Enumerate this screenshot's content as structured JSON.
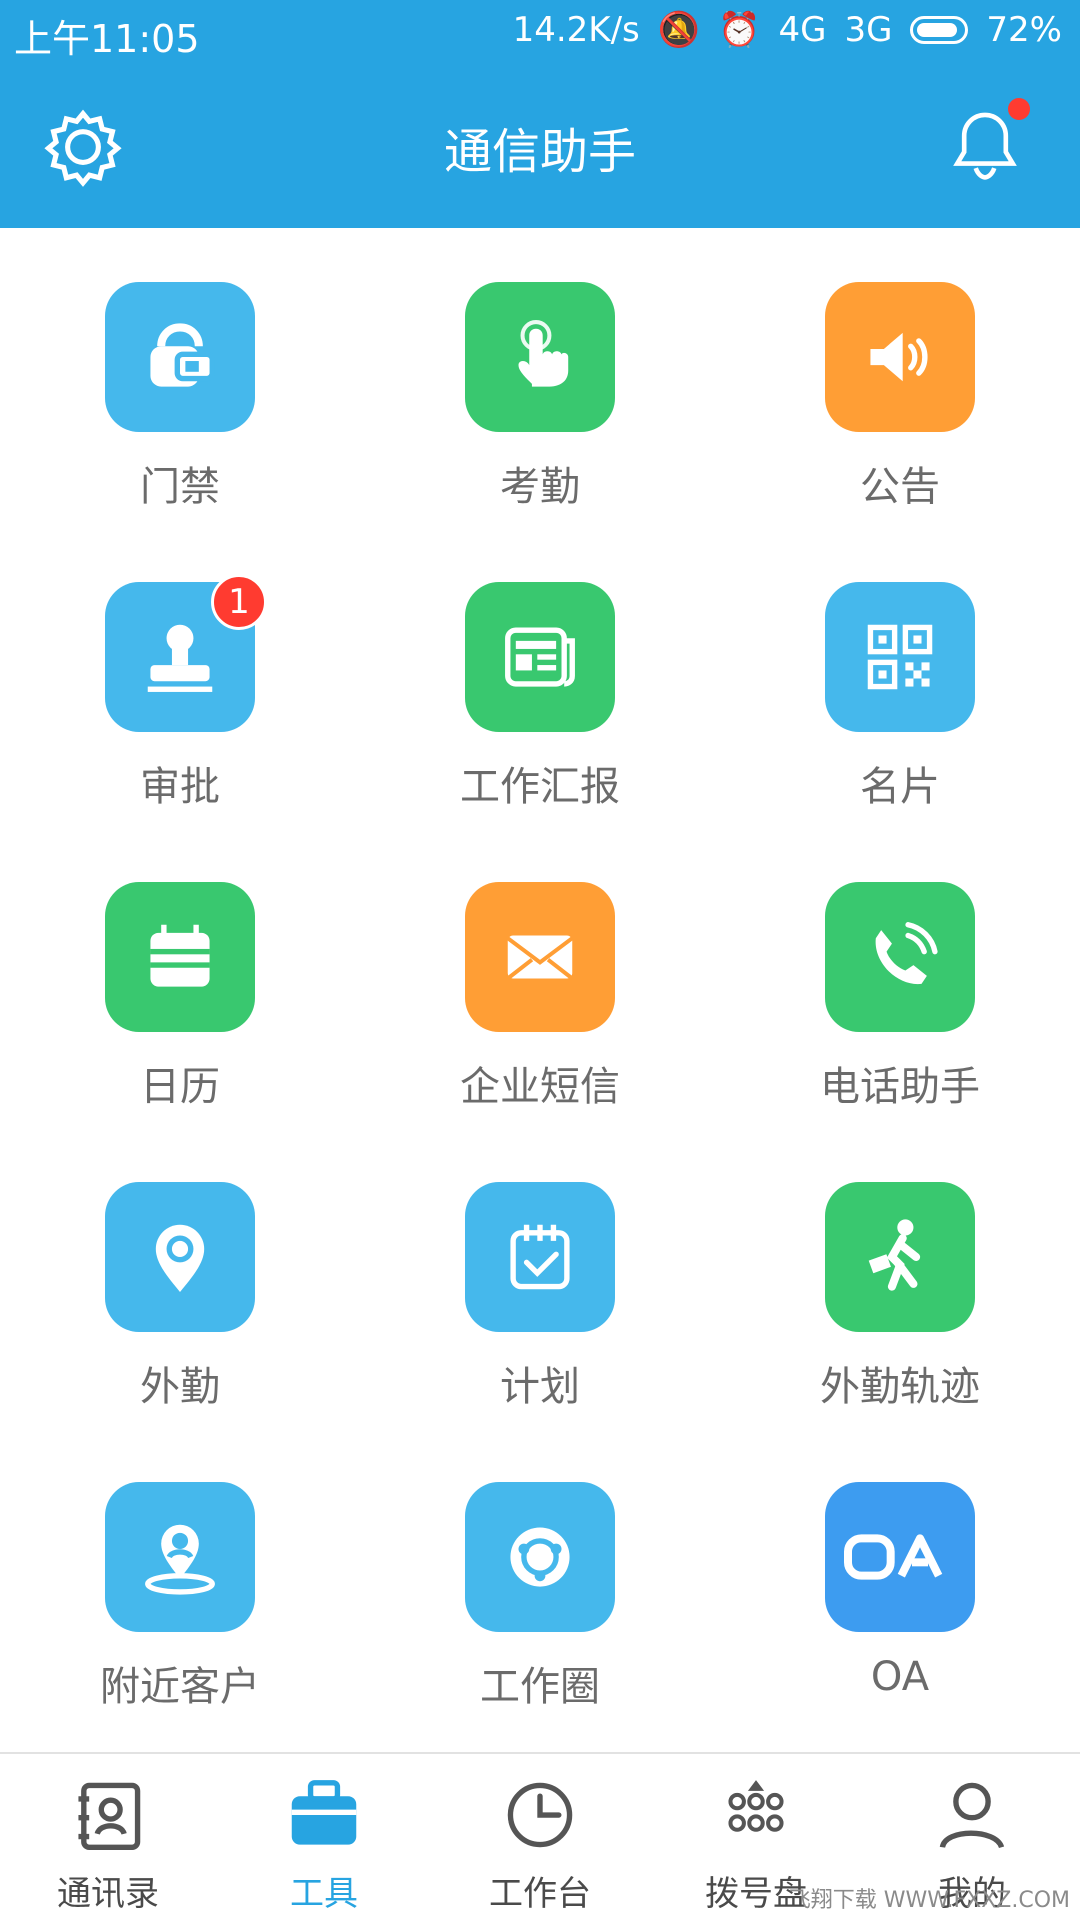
{
  "status_bar": {
    "time": "上午11:05",
    "net_speed": "14.2K/s",
    "network_1": "4G",
    "network_2": "3G",
    "battery_percent": "72%"
  },
  "header": {
    "title": "通信助手"
  },
  "tiles": [
    {
      "label": "门禁",
      "color": "#45b8ec",
      "icon": "access-control-icon"
    },
    {
      "label": "考勤",
      "color": "#39c86f",
      "icon": "touch-icon"
    },
    {
      "label": "公告",
      "color": "#ff9e35",
      "icon": "speaker-icon"
    },
    {
      "label": "审批",
      "color": "#45b8ec",
      "icon": "stamp-icon",
      "badge": "1"
    },
    {
      "label": "工作汇报",
      "color": "#39c86f",
      "icon": "newspaper-icon"
    },
    {
      "label": "名片",
      "color": "#45b8ec",
      "icon": "qr-code-icon"
    },
    {
      "label": "日历",
      "color": "#39c86f",
      "icon": "calendar-icon"
    },
    {
      "label": "企业短信",
      "color": "#ff9e35",
      "icon": "mail-icon"
    },
    {
      "label": "电话助手",
      "color": "#39c86f",
      "icon": "phone-icon"
    },
    {
      "label": "外勤",
      "color": "#45b8ec",
      "icon": "location-pin-icon"
    },
    {
      "label": "计划",
      "color": "#45b8ec",
      "icon": "plan-calendar-icon"
    },
    {
      "label": "外勤轨迹",
      "color": "#39c86f",
      "icon": "walking-person-icon"
    },
    {
      "label": "附近客户",
      "color": "#45b8ec",
      "icon": "nearby-customer-icon"
    },
    {
      "label": "工作圈",
      "color": "#45b8ec",
      "icon": "work-circle-icon"
    },
    {
      "label": "OA",
      "color": "#3d9cf0",
      "icon": "oa-icon"
    }
  ],
  "bottom_nav": [
    {
      "label": "通讯录",
      "icon": "contacts-icon",
      "active": false
    },
    {
      "label": "工具",
      "icon": "toolbox-icon",
      "active": true
    },
    {
      "label": "工作台",
      "icon": "clock-icon",
      "active": false
    },
    {
      "label": "拨号盘",
      "icon": "dialpad-icon",
      "active": false
    },
    {
      "label": "我的",
      "icon": "user-icon",
      "active": false
    }
  ],
  "watermark": "飞翔下载 WWW.FXXZ.COM",
  "accent_color": "#27a4e1"
}
